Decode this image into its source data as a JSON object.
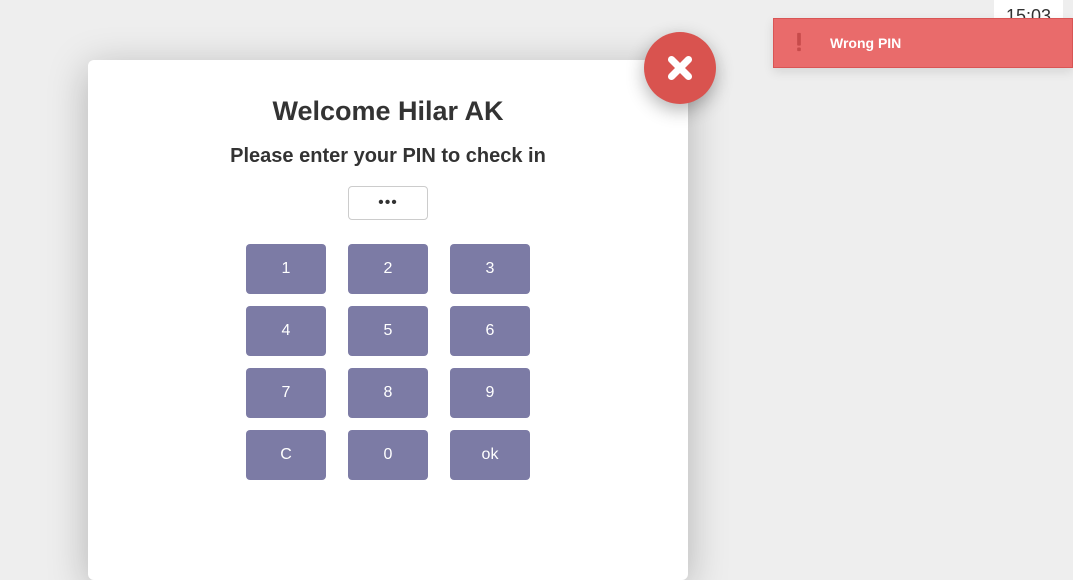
{
  "clock": {
    "time": "15:03"
  },
  "toast": {
    "message": "Wrong PIN",
    "color": "#e96b6b"
  },
  "modal": {
    "title": "Welcome Hilar AK",
    "subtitle": "Please enter your PIN to check in",
    "pin_masked": "•••",
    "close_icon": "close-icon",
    "keypad": {
      "rows": [
        [
          "1",
          "2",
          "3"
        ],
        [
          "4",
          "5",
          "6"
        ],
        [
          "7",
          "8",
          "9"
        ],
        [
          "C",
          "0",
          "ok"
        ]
      ]
    }
  },
  "colors": {
    "key_bg": "#7c7ba5",
    "close_bg": "#d9534f"
  }
}
